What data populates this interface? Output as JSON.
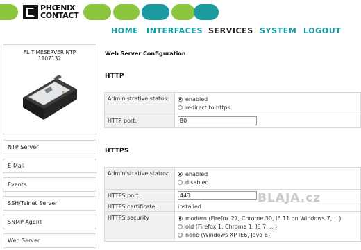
{
  "brand": {
    "logo_text_line1": "PHŒNIX",
    "logo_text_line2": "CONTACT",
    "accent_green": "#8cc63f",
    "accent_teal": "#1b9aa0"
  },
  "nav": {
    "items": [
      {
        "label": "HOME",
        "active": false
      },
      {
        "label": "INTERFACES",
        "active": false
      },
      {
        "label": "SERVICES",
        "active": true
      },
      {
        "label": "SYSTEM",
        "active": false
      },
      {
        "label": "LOGOUT",
        "active": false
      }
    ]
  },
  "device": {
    "name": "FL TIMESERVER NTP",
    "part_number": "1107132"
  },
  "sidebar": {
    "items": [
      {
        "label": "NTP Server"
      },
      {
        "label": "E-Mail"
      },
      {
        "label": "Events"
      },
      {
        "label": "SSH/Telnet Server"
      },
      {
        "label": "SNMP Agent"
      },
      {
        "label": "Web Server"
      }
    ]
  },
  "main": {
    "page_title": "Web Server Configuration",
    "http": {
      "title": "HTTP",
      "admin_status_label": "Administrative status:",
      "admin_status_options": [
        "enabled",
        "redirect to https"
      ],
      "admin_status_selected": "enabled",
      "port_label": "HTTP port:",
      "port_value": "80"
    },
    "https": {
      "title": "HTTPS",
      "admin_status_label": "Administrative status:",
      "admin_status_options": [
        "enabled",
        "disabled"
      ],
      "admin_status_selected": "enabled",
      "port_label": "HTTPS port:",
      "port_value": "443",
      "certificate_label": "HTTPS certificate:",
      "certificate_value": "installed",
      "security_label": "HTTPS security",
      "security_options": [
        "modern (Firefox 27, Chrome 30, IE 11 on Windows 7, ...)",
        "old (Firefox 1, Chrome 1, IE 7, ...)",
        "none (Windows XP IE6, Java 6)"
      ],
      "security_selected": "modern (Firefox 27, Chrome 30, IE 11 on Windows 7, ...)"
    }
  },
  "watermark": "BLAJA.cz"
}
